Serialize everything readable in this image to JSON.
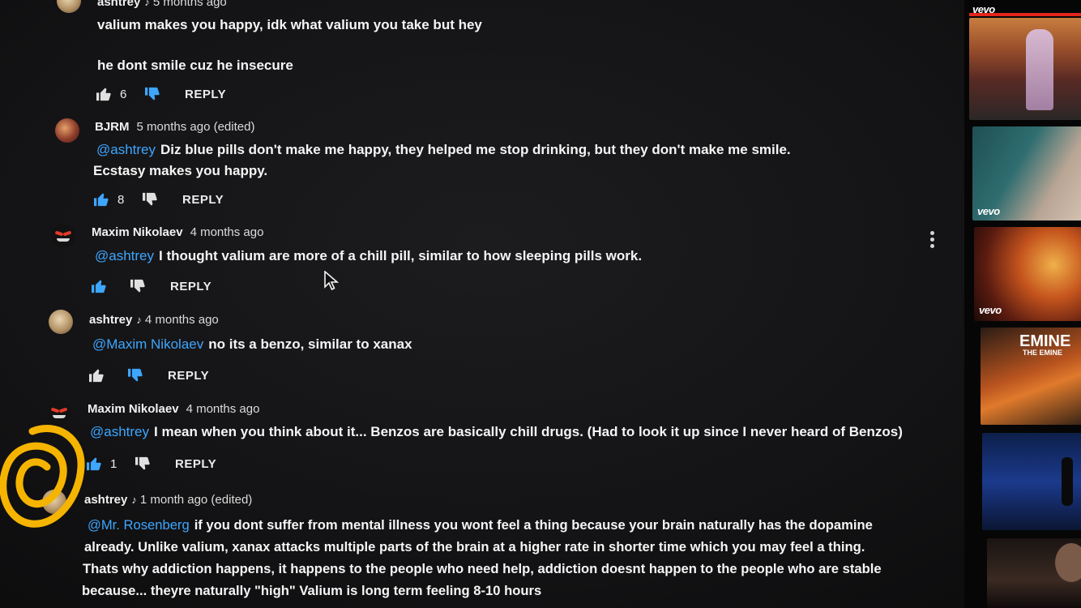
{
  "comments": [
    {
      "author": "ashtrey",
      "music": "♪",
      "time": "5 months ago",
      "mention": "",
      "lines": [
        "valium makes you happy, idk what valium you take but hey",
        "",
        "he dont smile cuz he insecure"
      ],
      "likes": "6",
      "reply": "REPLY"
    },
    {
      "author": "BJRM",
      "music": "",
      "time": "5 months ago (edited)",
      "mention": "@ashtrey",
      "lines": [
        "Diz blue pills don't make me happy, they helped me stop drinking, but they don't make me smile.",
        "Ecstasy makes you happy."
      ],
      "likes": "8",
      "reply": "REPLY"
    },
    {
      "author": "Maxim Nikolaev",
      "music": "",
      "time": "4 months ago",
      "mention": "@ashtrey",
      "lines": [
        "I thought valium are more of a chill pill, similar to how sleeping pills work."
      ],
      "likes": "",
      "reply": "REPLY"
    },
    {
      "author": "ashtrey",
      "music": "♪",
      "time": "4 months ago",
      "mention": "@Maxim Nikolaev",
      "lines": [
        "no its a benzo, similar to xanax"
      ],
      "likes": "",
      "reply": "REPLY"
    },
    {
      "author": "Maxim Nikolaev",
      "music": "",
      "time": "4 months ago",
      "mention": "@ashtrey",
      "lines": [
        "I mean when you think about it... Benzos are basically chill drugs. (Had to look it up since I never heard of Benzos)"
      ],
      "likes": "1",
      "reply": "REPLY"
    },
    {
      "author": "ashtrey",
      "music": "♪",
      "time": "1 month ago (edited)",
      "mention": "@Mr. Rosenberg",
      "lines": [
        "if you dont suffer from mental illness you wont feel a thing because your brain naturally has the dopamine",
        "already. Unlike valium, xanax attacks multiple parts of the brain at a higher rate in shorter time which you may feel a thing.",
        "Thats why addiction happens, it happens to the people who need help, addiction doesnt happen to the people who are stable",
        "because... theyre naturally \"high\" Valium is long term feeling 8-10 hours"
      ],
      "likes": "",
      "reply": ""
    }
  ],
  "sidebar": {
    "badges": [
      "vevo",
      "vevo",
      "vevo"
    ],
    "thumb4_text": [
      "EMINE",
      "THE EMINE"
    ]
  },
  "colors": {
    "mention": "#3ea6ff",
    "accent_red": "#e3261b",
    "annotation": "#f5b400",
    "bg": "#141416"
  }
}
